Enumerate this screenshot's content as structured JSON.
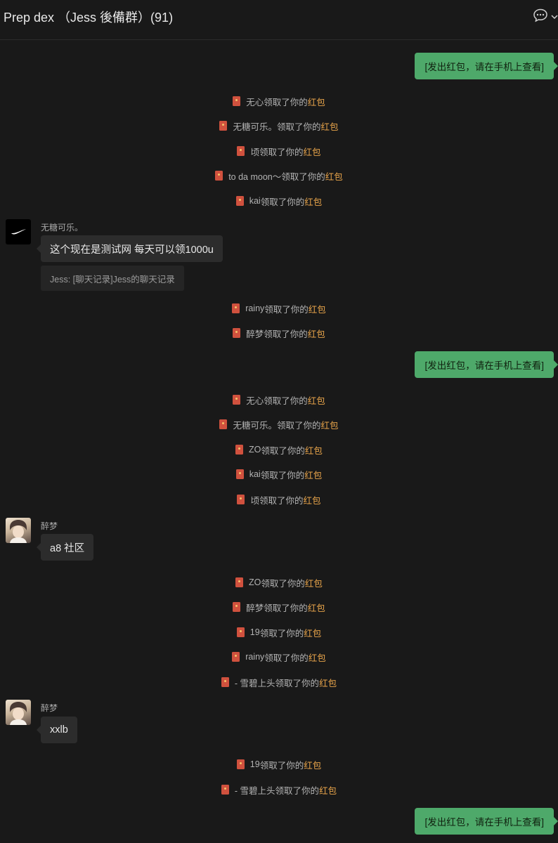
{
  "window": {
    "title": "Prep dex （Jess 後備群）(91)"
  },
  "labels": {
    "claimed_suffix": "领取了你的",
    "red_packet": "红包",
    "sent_red_packet": "[发出红包，请在手机上查看]"
  },
  "messages": [
    {
      "type": "outgoing",
      "text": "[发出红包，请在手机上查看]"
    },
    {
      "type": "system",
      "name": "无心",
      "action": "领取了你的",
      "link": "红包"
    },
    {
      "type": "system",
      "name": "无糖可乐。",
      "action": "领取了你的",
      "link": "红包"
    },
    {
      "type": "system",
      "name": "顷",
      "action": "领取了你的",
      "link": "红包"
    },
    {
      "type": "system",
      "name": "to da moon～",
      "action": "领取了你的",
      "link": "红包"
    },
    {
      "type": "system",
      "name": "kai ",
      "action": "领取了你的",
      "link": "红包"
    },
    {
      "type": "incoming",
      "sender": "无糖可乐。",
      "avatar": "nike-logo-icon",
      "text": "这个现在是测试网 每天可以领1000u",
      "quote": "Jess: [聊天记录]Jess的聊天记录"
    },
    {
      "type": "system",
      "name": "rainy ",
      "action": "领取了你的",
      "link": "红包"
    },
    {
      "type": "system",
      "name": "醉梦",
      "action": "领取了你的",
      "link": "红包"
    },
    {
      "type": "outgoing",
      "text": "[发出红包，请在手机上查看]"
    },
    {
      "type": "system",
      "name": "无心",
      "action": "领取了你的",
      "link": "红包"
    },
    {
      "type": "system",
      "name": "无糖可乐。",
      "action": "领取了你的",
      "link": "红包"
    },
    {
      "type": "system",
      "name": "ZO ",
      "action": "领取了你的",
      "link": "红包"
    },
    {
      "type": "system",
      "name": "kai ",
      "action": "领取了你的",
      "link": "红包"
    },
    {
      "type": "system",
      "name": "顷",
      "action": "领取了你的",
      "link": "红包"
    },
    {
      "type": "incoming",
      "sender": "醉梦",
      "avatar": "anime-avatar",
      "text": "a8 社区"
    },
    {
      "type": "system",
      "name": "ZO ",
      "action": "领取了你的",
      "link": "红包"
    },
    {
      "type": "system",
      "name": "醉梦",
      "action": "领取了你的",
      "link": "红包"
    },
    {
      "type": "system",
      "name": "19 ",
      "action": "领取了你的",
      "link": "红包"
    },
    {
      "type": "system",
      "name": "rainy ",
      "action": "领取了你的",
      "link": "红包"
    },
    {
      "type": "system",
      "name": "- 雪碧上头",
      "action": "领取了你的",
      "link": "红包"
    },
    {
      "type": "incoming",
      "sender": "醉梦",
      "avatar": "anime-avatar",
      "text": "xxlb"
    },
    {
      "type": "system",
      "name": "19 ",
      "action": "领取了你的",
      "link": "红包"
    },
    {
      "type": "system",
      "name": "- 雪碧上头",
      "action": "领取了你的",
      "link": "红包"
    },
    {
      "type": "outgoing",
      "text": "[发出红包，请在手机上查看]"
    }
  ]
}
